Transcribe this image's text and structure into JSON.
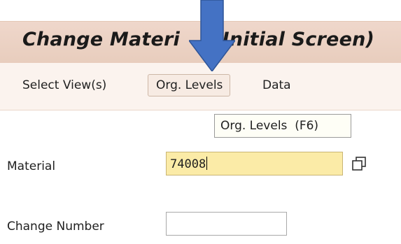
{
  "screen": {
    "title": "Change Materi     (Initial Screen)"
  },
  "toolbar": {
    "select_views_label": "Select View(s)",
    "org_levels_label": "Org. Levels",
    "data_label": "Data"
  },
  "tooltip": {
    "text": "Org. Levels  (F6)"
  },
  "form": {
    "material_label": "Material",
    "material_value": "74008",
    "change_number_label": "Change Number",
    "change_number_value": ""
  },
  "icons": {
    "annotation_arrow": "down-arrow-icon",
    "possible_entries": "possible-entries-icon"
  },
  "colors": {
    "title_bar": "#e8cdbd",
    "required_field": "#fbeba7",
    "arrow": "#4472c4"
  }
}
